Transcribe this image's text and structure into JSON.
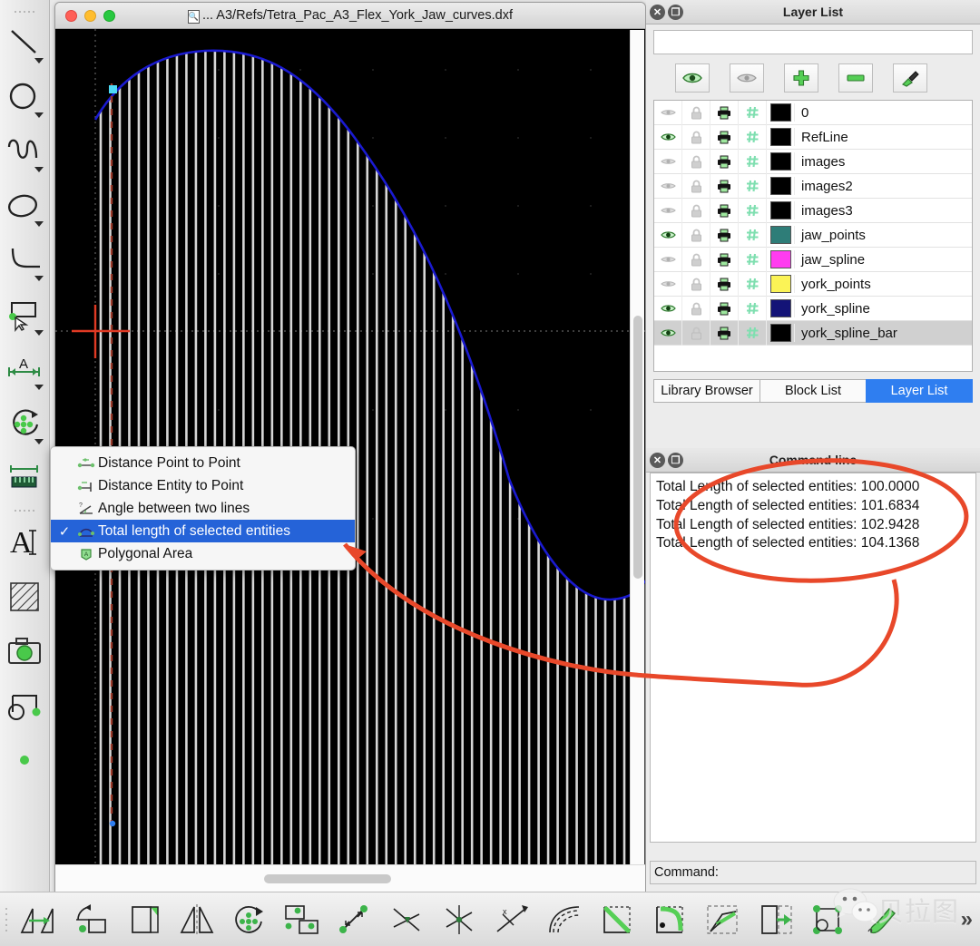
{
  "window": {
    "title": "... A3/Refs/Tetra_Pac_A3_Flex_York_Jaw_curves.dxf",
    "doc_icon": "document-search-icon",
    "traffic_lights": [
      "close",
      "minimize",
      "zoom"
    ]
  },
  "left_toolbar": {
    "items": [
      {
        "name": "line-tool",
        "icon": "line-icon"
      },
      {
        "name": "circle-tool",
        "icon": "circle-icon"
      },
      {
        "name": "spline-tool",
        "icon": "spline-icon"
      },
      {
        "name": "ellipse-tool",
        "icon": "ellipse-icon"
      },
      {
        "name": "arc-tool",
        "icon": "arc-icon"
      },
      {
        "name": "select-tool",
        "icon": "rectangle-select-icon"
      },
      {
        "name": "dimension-tool",
        "icon": "dimension-icon"
      },
      {
        "name": "modify-tool",
        "icon": "move-rotate-icon"
      },
      {
        "name": "measure-tool",
        "icon": "ruler-icon"
      },
      {
        "name": "text-tool",
        "icon": "text-cursor-icon"
      },
      {
        "name": "hatch-tool",
        "icon": "hatch-icon"
      },
      {
        "name": "image-tool",
        "icon": "camera-icon"
      },
      {
        "name": "block-tool",
        "icon": "block-icon"
      },
      {
        "name": "point-tool",
        "icon": "point-icon"
      }
    ]
  },
  "context_menu": {
    "items": [
      {
        "label": "Distance Point to Point",
        "icon": "distance-point-to-point-icon",
        "checked": false
      },
      {
        "label": "Distance Entity to Point",
        "icon": "distance-entity-to-point-icon",
        "checked": false
      },
      {
        "label": "Angle between two lines",
        "icon": "angle-between-lines-icon",
        "checked": false
      },
      {
        "label": "Total length of selected entities",
        "icon": "total-length-icon",
        "checked": true
      },
      {
        "label": "Polygonal Area",
        "icon": "polygonal-area-icon",
        "checked": false
      }
    ],
    "check_glyph": "✓"
  },
  "layer_panel": {
    "title": "Layer List",
    "close_glyph": "✕",
    "float_glyph": "❐",
    "search_value": "",
    "search_placeholder": "",
    "toolbar": [
      {
        "name": "show-all-layers-button",
        "icon": "eye-open-icon"
      },
      {
        "name": "hide-all-layers-button",
        "icon": "eye-closed-icon"
      },
      {
        "name": "add-layer-button",
        "icon": "plus-icon"
      },
      {
        "name": "remove-layer-button",
        "icon": "minus-icon"
      },
      {
        "name": "edit-layer-button",
        "icon": "edit-layer-icon"
      }
    ],
    "column_icons": [
      "visibility-icon",
      "lock-icon",
      "print-icon",
      "construction-icon",
      "color-swatch"
    ],
    "layers": [
      {
        "name": "0",
        "visible": false,
        "color": "#000000"
      },
      {
        "name": "RefLine",
        "visible": true,
        "color": "#000000"
      },
      {
        "name": "images",
        "visible": false,
        "color": "#000000"
      },
      {
        "name": "images2",
        "visible": false,
        "color": "#000000"
      },
      {
        "name": "images3",
        "visible": false,
        "color": "#000000"
      },
      {
        "name": "jaw_points",
        "visible": true,
        "color": "#2e7d78"
      },
      {
        "name": "jaw_spline",
        "visible": false,
        "color": "#ff3cf0"
      },
      {
        "name": "york_points",
        "visible": false,
        "color": "#fbf356"
      },
      {
        "name": "york_spline",
        "visible": true,
        "color": "#131377"
      },
      {
        "name": "york_spline_bar",
        "visible": true,
        "color": "#000000",
        "selected": true
      }
    ]
  },
  "tabs": [
    {
      "label": "Library Browser",
      "active": false
    },
    {
      "label": "Block List",
      "active": false
    },
    {
      "label": "Layer List",
      "active": true
    }
  ],
  "command_panel": {
    "title": "Command line",
    "close_glyph": "✕",
    "float_glyph": "❐",
    "lines": [
      "Total Length of selected entities: 100.0000",
      "Total Length of selected entities: 101.6834",
      "Total Length of selected entities: 102.9428",
      "Total Length of selected entities: 104.1368"
    ],
    "prompt": "Command:"
  },
  "bottom_toolbar": {
    "items": [
      {
        "name": "move-tool",
        "icon": "move-icon"
      },
      {
        "name": "rotate-tool",
        "icon": "rotate-icon"
      },
      {
        "name": "scale-tool",
        "icon": "scale-icon"
      },
      {
        "name": "mirror-tool",
        "icon": "mirror-icon"
      },
      {
        "name": "rotate-two-tool",
        "icon": "rotate-two-icon"
      },
      {
        "name": "move-copy-tool",
        "icon": "move-copy-icon"
      },
      {
        "name": "stretch-tool",
        "icon": "stretch-icon"
      },
      {
        "name": "trim-tool",
        "icon": "trim-icon"
      },
      {
        "name": "trim-two-tool",
        "icon": "trim-two-icon"
      },
      {
        "name": "lengthen-tool",
        "icon": "lengthen-icon"
      },
      {
        "name": "offset-tool",
        "icon": "offset-icon"
      },
      {
        "name": "bevel-tool",
        "icon": "bevel-icon"
      },
      {
        "name": "round-tool",
        "icon": "round-icon"
      },
      {
        "name": "divide-tool",
        "icon": "divide-icon"
      },
      {
        "name": "explode-tool",
        "icon": "explode-icon"
      },
      {
        "name": "break-tool",
        "icon": "break-icon"
      },
      {
        "name": "properties-tool",
        "icon": "properties-brush-icon"
      }
    ],
    "overflow_glyph": "»"
  },
  "canvas": {
    "background": "#000000",
    "spline_color": "#1a1ad0",
    "bar_color": "#d8d8d8",
    "axis_color": "#5a5a5a",
    "origin_marker_color": "#e03a24",
    "selection_marker_color": "#4ddbf5",
    "dashed_line_color": "#9b3a2a",
    "bar_count": 58
  },
  "annotations": {
    "color": "#e8482a",
    "circle_label": "highlight-ellipse",
    "arrow_label": "pointer-arrow"
  },
  "watermark": {
    "text": "贝拉图",
    "logo": "wechat-logo"
  }
}
